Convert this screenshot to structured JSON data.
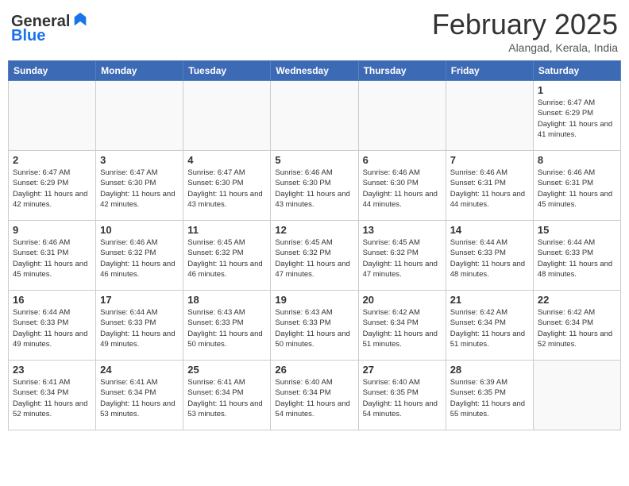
{
  "header": {
    "logo_line1": "General",
    "logo_line2": "Blue",
    "month": "February 2025",
    "location": "Alangad, Kerala, India"
  },
  "weekdays": [
    "Sunday",
    "Monday",
    "Tuesday",
    "Wednesday",
    "Thursday",
    "Friday",
    "Saturday"
  ],
  "weeks": [
    [
      {
        "day": "",
        "sunrise": "",
        "sunset": "",
        "daylight": ""
      },
      {
        "day": "",
        "sunrise": "",
        "sunset": "",
        "daylight": ""
      },
      {
        "day": "",
        "sunrise": "",
        "sunset": "",
        "daylight": ""
      },
      {
        "day": "",
        "sunrise": "",
        "sunset": "",
        "daylight": ""
      },
      {
        "day": "",
        "sunrise": "",
        "sunset": "",
        "daylight": ""
      },
      {
        "day": "",
        "sunrise": "",
        "sunset": "",
        "daylight": ""
      },
      {
        "day": "1",
        "sunrise": "Sunrise: 6:47 AM",
        "sunset": "Sunset: 6:29 PM",
        "daylight": "Daylight: 11 hours and 41 minutes."
      }
    ],
    [
      {
        "day": "2",
        "sunrise": "Sunrise: 6:47 AM",
        "sunset": "Sunset: 6:29 PM",
        "daylight": "Daylight: 11 hours and 42 minutes."
      },
      {
        "day": "3",
        "sunrise": "Sunrise: 6:47 AM",
        "sunset": "Sunset: 6:30 PM",
        "daylight": "Daylight: 11 hours and 42 minutes."
      },
      {
        "day": "4",
        "sunrise": "Sunrise: 6:47 AM",
        "sunset": "Sunset: 6:30 PM",
        "daylight": "Daylight: 11 hours and 43 minutes."
      },
      {
        "day": "5",
        "sunrise": "Sunrise: 6:46 AM",
        "sunset": "Sunset: 6:30 PM",
        "daylight": "Daylight: 11 hours and 43 minutes."
      },
      {
        "day": "6",
        "sunrise": "Sunrise: 6:46 AM",
        "sunset": "Sunset: 6:30 PM",
        "daylight": "Daylight: 11 hours and 44 minutes."
      },
      {
        "day": "7",
        "sunrise": "Sunrise: 6:46 AM",
        "sunset": "Sunset: 6:31 PM",
        "daylight": "Daylight: 11 hours and 44 minutes."
      },
      {
        "day": "8",
        "sunrise": "Sunrise: 6:46 AM",
        "sunset": "Sunset: 6:31 PM",
        "daylight": "Daylight: 11 hours and 45 minutes."
      }
    ],
    [
      {
        "day": "9",
        "sunrise": "Sunrise: 6:46 AM",
        "sunset": "Sunset: 6:31 PM",
        "daylight": "Daylight: 11 hours and 45 minutes."
      },
      {
        "day": "10",
        "sunrise": "Sunrise: 6:46 AM",
        "sunset": "Sunset: 6:32 PM",
        "daylight": "Daylight: 11 hours and 46 minutes."
      },
      {
        "day": "11",
        "sunrise": "Sunrise: 6:45 AM",
        "sunset": "Sunset: 6:32 PM",
        "daylight": "Daylight: 11 hours and 46 minutes."
      },
      {
        "day": "12",
        "sunrise": "Sunrise: 6:45 AM",
        "sunset": "Sunset: 6:32 PM",
        "daylight": "Daylight: 11 hours and 47 minutes."
      },
      {
        "day": "13",
        "sunrise": "Sunrise: 6:45 AM",
        "sunset": "Sunset: 6:32 PM",
        "daylight": "Daylight: 11 hours and 47 minutes."
      },
      {
        "day": "14",
        "sunrise": "Sunrise: 6:44 AM",
        "sunset": "Sunset: 6:33 PM",
        "daylight": "Daylight: 11 hours and 48 minutes."
      },
      {
        "day": "15",
        "sunrise": "Sunrise: 6:44 AM",
        "sunset": "Sunset: 6:33 PM",
        "daylight": "Daylight: 11 hours and 48 minutes."
      }
    ],
    [
      {
        "day": "16",
        "sunrise": "Sunrise: 6:44 AM",
        "sunset": "Sunset: 6:33 PM",
        "daylight": "Daylight: 11 hours and 49 minutes."
      },
      {
        "day": "17",
        "sunrise": "Sunrise: 6:44 AM",
        "sunset": "Sunset: 6:33 PM",
        "daylight": "Daylight: 11 hours and 49 minutes."
      },
      {
        "day": "18",
        "sunrise": "Sunrise: 6:43 AM",
        "sunset": "Sunset: 6:33 PM",
        "daylight": "Daylight: 11 hours and 50 minutes."
      },
      {
        "day": "19",
        "sunrise": "Sunrise: 6:43 AM",
        "sunset": "Sunset: 6:33 PM",
        "daylight": "Daylight: 11 hours and 50 minutes."
      },
      {
        "day": "20",
        "sunrise": "Sunrise: 6:42 AM",
        "sunset": "Sunset: 6:34 PM",
        "daylight": "Daylight: 11 hours and 51 minutes."
      },
      {
        "day": "21",
        "sunrise": "Sunrise: 6:42 AM",
        "sunset": "Sunset: 6:34 PM",
        "daylight": "Daylight: 11 hours and 51 minutes."
      },
      {
        "day": "22",
        "sunrise": "Sunrise: 6:42 AM",
        "sunset": "Sunset: 6:34 PM",
        "daylight": "Daylight: 11 hours and 52 minutes."
      }
    ],
    [
      {
        "day": "23",
        "sunrise": "Sunrise: 6:41 AM",
        "sunset": "Sunset: 6:34 PM",
        "daylight": "Daylight: 11 hours and 52 minutes."
      },
      {
        "day": "24",
        "sunrise": "Sunrise: 6:41 AM",
        "sunset": "Sunset: 6:34 PM",
        "daylight": "Daylight: 11 hours and 53 minutes."
      },
      {
        "day": "25",
        "sunrise": "Sunrise: 6:41 AM",
        "sunset": "Sunset: 6:34 PM",
        "daylight": "Daylight: 11 hours and 53 minutes."
      },
      {
        "day": "26",
        "sunrise": "Sunrise: 6:40 AM",
        "sunset": "Sunset: 6:34 PM",
        "daylight": "Daylight: 11 hours and 54 minutes."
      },
      {
        "day": "27",
        "sunrise": "Sunrise: 6:40 AM",
        "sunset": "Sunset: 6:35 PM",
        "daylight": "Daylight: 11 hours and 54 minutes."
      },
      {
        "day": "28",
        "sunrise": "Sunrise: 6:39 AM",
        "sunset": "Sunset: 6:35 PM",
        "daylight": "Daylight: 11 hours and 55 minutes."
      },
      {
        "day": "",
        "sunrise": "",
        "sunset": "",
        "daylight": ""
      }
    ]
  ]
}
